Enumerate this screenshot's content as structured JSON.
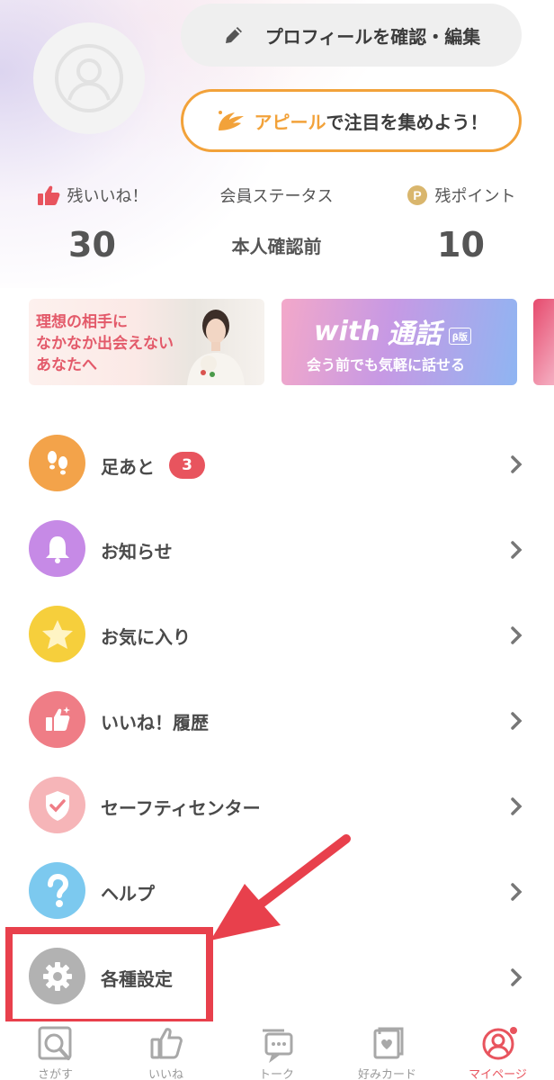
{
  "header": {
    "profile_button": "プロフィールを確認・編集",
    "appeal_accent": "アピール",
    "appeal_rest": "で注目を集めよう！"
  },
  "stats": {
    "likes_left": {
      "label": "残いいね！",
      "value": "30"
    },
    "member_status": {
      "label": "会員ステータス",
      "value": "本人確認前"
    },
    "points": {
      "label": "残ポイント",
      "value": "10"
    }
  },
  "banners": {
    "ideal": {
      "line1": "理想の相手に",
      "line2": "なかなか出会えない",
      "line3": "あなたへ"
    },
    "call": {
      "title_latin": "with",
      "title_jp": "通話",
      "beta": "β版",
      "subtitle": "会う前でも気軽に話せる"
    }
  },
  "menu": [
    {
      "label": "足あと",
      "badge": "3",
      "icon": "footprints-icon",
      "color": "#f3a34a"
    },
    {
      "label": "お知らせ",
      "icon": "bell-icon",
      "color": "#c68ae6"
    },
    {
      "label": "お気に入り",
      "icon": "star-icon",
      "color": "#f6cf3c"
    },
    {
      "label": "いいね！履歴",
      "icon": "thumbs-up-icon",
      "color": "#ef7d86"
    },
    {
      "label": "セーフティセンター",
      "icon": "shield-icon",
      "color": "#f6b5b8"
    },
    {
      "label": "ヘルプ",
      "icon": "question-icon",
      "color": "#7cc9ef"
    },
    {
      "label": "各種設定",
      "icon": "gear-icon",
      "color": "#b2b2b2"
    }
  ],
  "tabs": [
    {
      "label": "さがす",
      "icon": "search-icon"
    },
    {
      "label": "いいね",
      "icon": "like-icon"
    },
    {
      "label": "トーク",
      "icon": "chat-icon"
    },
    {
      "label": "好みカード",
      "icon": "card-icon"
    },
    {
      "label": "マイページ",
      "icon": "profile-icon",
      "active": true
    }
  ],
  "colors": {
    "accent_orange": "#f2a23a",
    "accent_red": "#e8545e",
    "highlight_red": "#e8404c"
  }
}
